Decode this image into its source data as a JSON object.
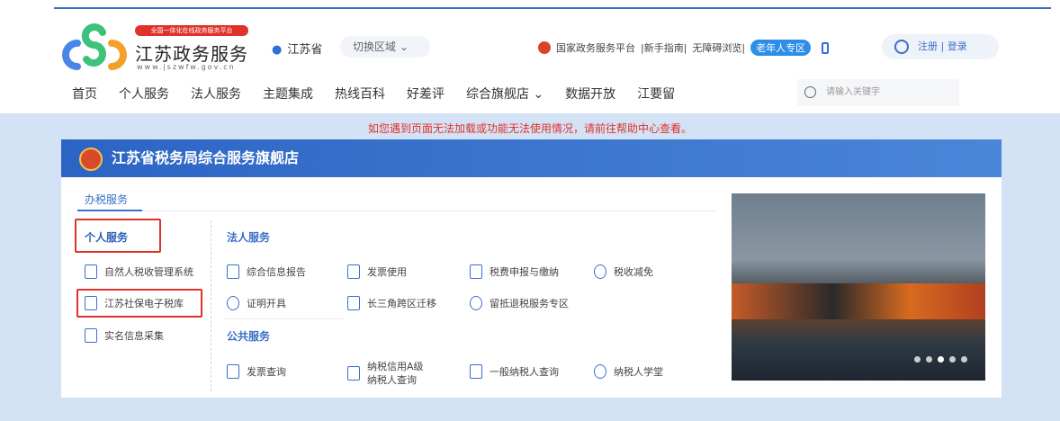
{
  "header": {
    "badge": "全国一体化在线政务服务平台",
    "brand": "江苏政务服务",
    "url": "www.jszwfw.gov.cn",
    "location": "江苏省",
    "region_switch": "切换区域 ⌄",
    "links": [
      "国家政务服务平台",
      "|新手指南|",
      "无障碍浏览|"
    ],
    "elder": "老年人专区",
    "register": "注册",
    "sep": " | ",
    "login": "登录"
  },
  "nav": [
    "首页",
    "个人服务",
    "法人服务",
    "主题集成",
    "热线百科",
    "好差评",
    "综合旗舰店 ⌄",
    "数据开放",
    "江要留"
  ],
  "search": {
    "placeholder": "请输入关键字"
  },
  "notice": "如您遇到页面无法加载或功能无法使用情况，请前往帮助中心查看。",
  "card": {
    "title": "江苏省税务局综合服务旗舰店",
    "tab": "办税服务",
    "personal": {
      "title": "个人服务",
      "items": [
        "自然人税收管理系统",
        "江苏社保电子税库",
        "实名信息采集"
      ]
    },
    "legal": {
      "title": "法人服务",
      "items": [
        "综合信息报告",
        "发票使用",
        "税费申报与缴纳",
        "税收减免",
        "证明开具",
        "长三角跨区迁移",
        "留抵退税服务专区"
      ]
    },
    "public": {
      "title": "公共服务",
      "items": [
        "发票查询",
        "纳税信用A级纳税人查询",
        "一般纳税人查询",
        "纳税人学堂"
      ]
    },
    "carousel": {
      "slides": 5,
      "active": 3
    }
  }
}
